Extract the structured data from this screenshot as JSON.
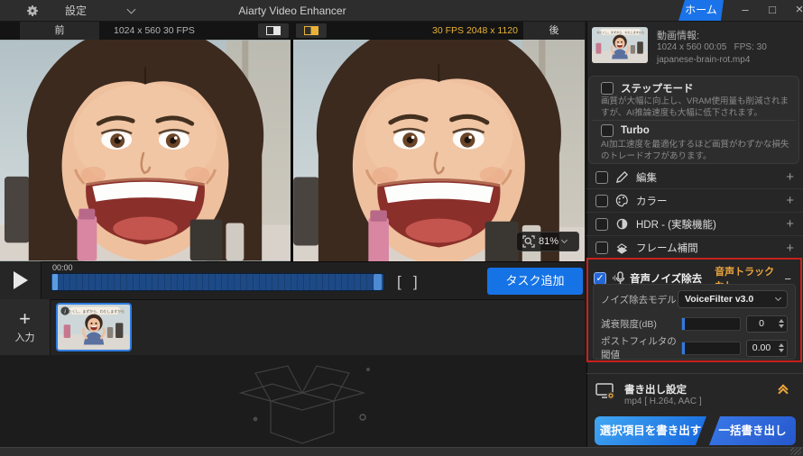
{
  "colors": {
    "accent_blue": "#1a73e8",
    "highlight_red": "#c8201d",
    "warning_yellow": "#eda63c",
    "timeline_blue": "#1d4a86"
  },
  "titlebar": {
    "settings_label": "設定",
    "app_title": "Aiarty Video Enhancer",
    "home_button": "ホーム",
    "minimize": "–",
    "maximize": "□",
    "close": "×"
  },
  "preview": {
    "before_tab": "前",
    "before_info": "1024 x 560  30 FPS",
    "after_info": "30 FPS  2048 x 1120",
    "after_tab": "後",
    "zoom_level": "81%"
  },
  "timeline": {
    "time_label": "00:00",
    "trim_open": "[",
    "trim_close": "]",
    "add_task_button": "タスク追加"
  },
  "input_panel": {
    "add_plus": "+",
    "add_label": "入力",
    "thumb_caption": "わたくし、まずから、わたしますから"
  },
  "sidebar": {
    "video_info": {
      "title": "動画情報:",
      "dimensions": "1024 x 560  00:05",
      "fps": "FPS: 30",
      "filename": "japanese-brain-rot.mp4"
    },
    "step_mode": {
      "label": "ステップモード",
      "desc": "画質が大幅に向上し、VRAM使用量も削減されますが、AI推論速度も大幅に低下されます。"
    },
    "turbo": {
      "label": "Turbo",
      "desc": "AI加工速度を最適化するほど画質がわずかな損失のトレードオフがあります。"
    },
    "sections": [
      {
        "label": "編集"
      },
      {
        "label": "カラー"
      },
      {
        "label": "HDR - (実験機能)"
      },
      {
        "label": "フレーム補間"
      }
    ],
    "audio_denoise": {
      "label": "音声ノイズ除去",
      "status": "音声トラックなし",
      "minus": "−",
      "model_label": "ノイズ除去モデル",
      "model_value": "VoiceFilter v3.0",
      "attenuation_label": "減衰限度(dB)",
      "attenuation_value": "0",
      "threshold_label": "ポストフィルタの閾値",
      "threshold_value": "0.00"
    },
    "export": {
      "title": "書き出し設定",
      "format": "mp4 [ H.264, AAC ]",
      "export_selected_button": "選択項目を書き出す",
      "export_all_button": "一括書き出し"
    }
  }
}
